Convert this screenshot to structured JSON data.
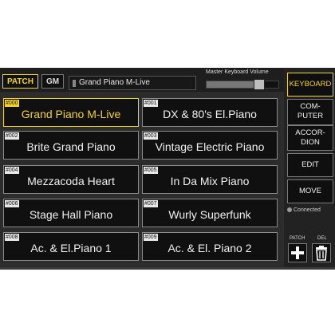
{
  "header": {
    "modes": [
      {
        "label": "PATCH",
        "active": true
      },
      {
        "label": "GM",
        "active": false
      }
    ],
    "current_patch": "Grand Piano M-Live",
    "volume_label": "Master Keyboard Volume",
    "volume_level": 0.78
  },
  "patches": [
    {
      "num": "#000",
      "name": "Grand Piano M-Live",
      "selected": true
    },
    {
      "num": "#001",
      "name": "DX & 80's El.Piano",
      "selected": false
    },
    {
      "num": "#002",
      "name": "Brite Grand Piano",
      "selected": false
    },
    {
      "num": "#003",
      "name": "Vintage Electric Piano",
      "selected": false
    },
    {
      "num": "#004",
      "name": "Mezzacoda Heart",
      "selected": false
    },
    {
      "num": "#005",
      "name": "In Da Mix Piano",
      "selected": false
    },
    {
      "num": "#006",
      "name": "Stage Hall Piano",
      "selected": false
    },
    {
      "num": "#007",
      "name": "Wurly Superfunk",
      "selected": false
    },
    {
      "num": "#008",
      "name": "Ac. & El.Piano 1",
      "selected": false
    },
    {
      "num": "#009",
      "name": "Ac. & El. Piano 2",
      "selected": false
    }
  ],
  "sidebar": {
    "keyboard": "KEYBOARD",
    "computer_lines": [
      "COM-",
      "PUTER"
    ],
    "accordion_lines": [
      "ACCOR-",
      "DION"
    ],
    "edit": "EDIT",
    "move": "MOVE",
    "status": "Connected",
    "patch_label": "PATCH",
    "del_label": "DEL"
  },
  "colors": {
    "accent": "#f2d32a",
    "background": "#2c2c2c",
    "tile": "#101010"
  },
  "icons": {
    "add": "plus-icon",
    "delete": "trash-icon",
    "status": "connection-icon"
  }
}
